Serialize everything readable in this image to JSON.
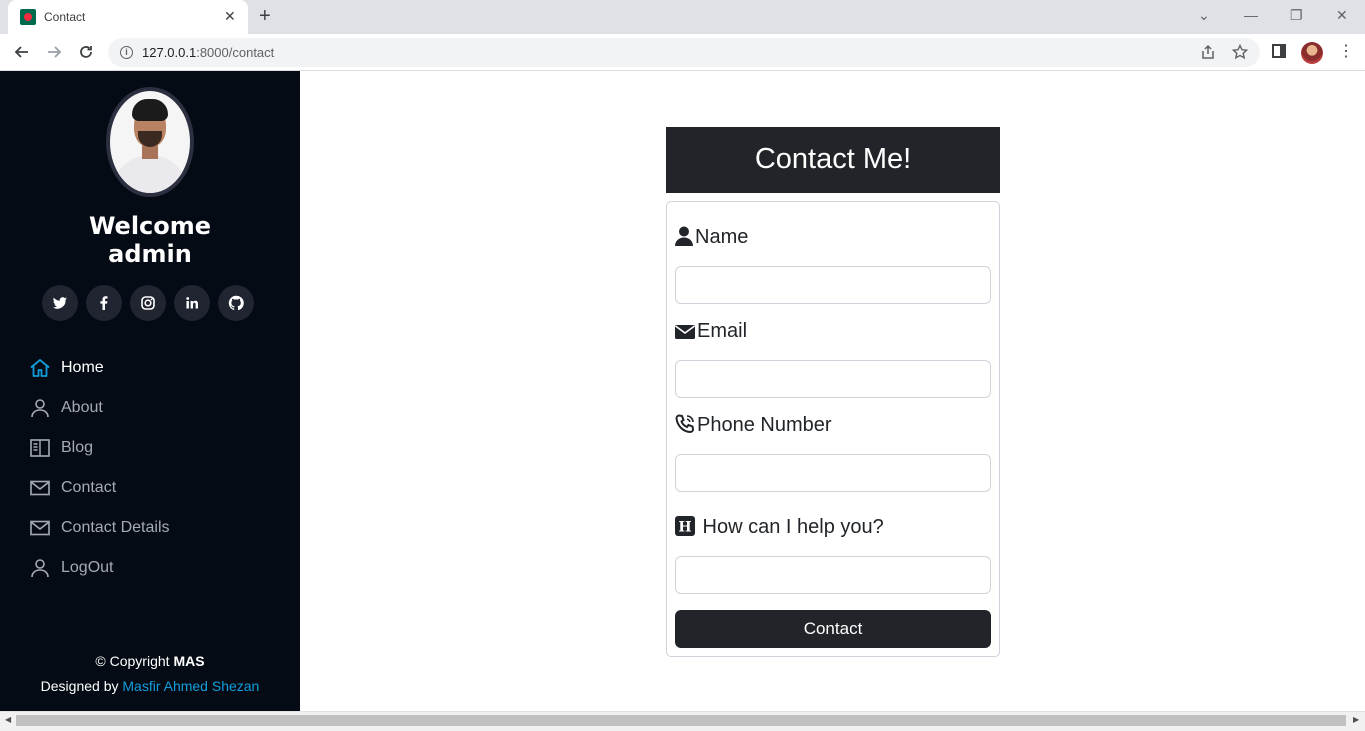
{
  "browser": {
    "tab_title": "Contact",
    "tab_close": "✕",
    "new_tab": "+",
    "url_host": "127.0.0.1",
    "url_rest": ":8000/contact",
    "controls": {
      "chevron": "⌄",
      "minimize": "—",
      "restore": "❐",
      "close": "✕"
    },
    "menu": "⋮"
  },
  "sidebar": {
    "welcome_line1": "Welcome",
    "welcome_line2": "admin",
    "socials": [
      "twitter-icon",
      "facebook-icon",
      "instagram-icon",
      "linkedin-icon",
      "github-icon"
    ],
    "nav": [
      {
        "label": "Home",
        "icon": "home-icon",
        "active": true
      },
      {
        "label": "About",
        "icon": "person-icon"
      },
      {
        "label": "Blog",
        "icon": "book-icon"
      },
      {
        "label": "Contact",
        "icon": "envelope-icon"
      },
      {
        "label": "Contact Details",
        "icon": "envelope-icon"
      },
      {
        "label": "LogOut",
        "icon": "person-icon"
      }
    ],
    "copyright_prefix": "© Copyright ",
    "copyright_brand": "MAS",
    "designed_prefix": "Designed by ",
    "designer": "Masfir Ahmed Shezan"
  },
  "contact": {
    "title": "Contact Me!",
    "name_label": "Name",
    "email_label": "Email",
    "phone_label": "Phone Number",
    "help_label": " How can I help you?",
    "submit_label": "Contact"
  },
  "colors": {
    "sidebar_bg": "#040b14",
    "accent": "#149ddd",
    "dark": "#212529"
  }
}
